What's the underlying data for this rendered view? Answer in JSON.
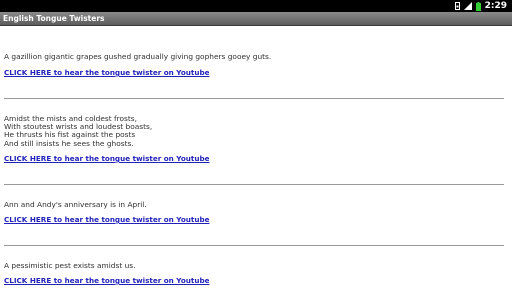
{
  "status_bar": {
    "time": "2:29",
    "icons": [
      "sim-icon",
      "signal-icon",
      "battery-icon"
    ]
  },
  "app": {
    "title": "English Tongue Twisters"
  },
  "twisters": [
    {
      "text": "A gazillion gigantic grapes gushed gradually giving gophers gooey guts.",
      "link": "CLICK HERE to hear the tongue twister on Youtube"
    },
    {
      "text": "Amidst the mists and coldest frosts,\nWith stoutest wrists and loudest boasts,\nHe thrusts his fist against the posts\nAnd still insists he sees the ghosts.",
      "link": "CLICK HERE to hear the tongue twister on Youtube"
    },
    {
      "text": "Ann and Andy's anniversary is in April.",
      "link": "CLICK HERE to hear the tongue twister on Youtube"
    },
    {
      "text": "A pessimistic pest exists amidst us.",
      "link": "CLICK HERE to hear the tongue twister on Youtube"
    }
  ],
  "colors": {
    "status_bar": "#000000",
    "title_bar": "#6e6e6e",
    "link": "#2222bb",
    "text": "#303030",
    "divider": "#9a9a9a"
  }
}
